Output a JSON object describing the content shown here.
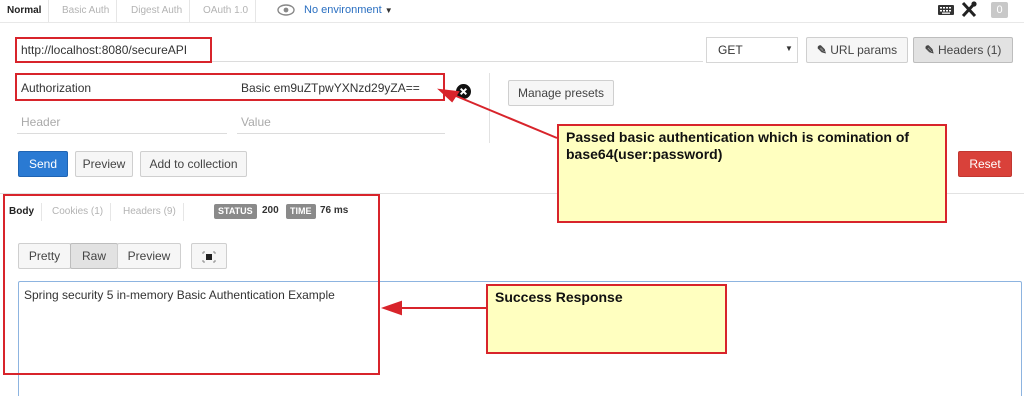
{
  "auth_tabs": [
    "Normal",
    "Basic Auth",
    "Digest Auth",
    "OAuth 1.0"
  ],
  "environment": {
    "label": "No environment",
    "icon": "eye-icon"
  },
  "toolbar_icons": {
    "keyboard": "keyboard-icon",
    "tools": "wrench-icon",
    "count": "0"
  },
  "request": {
    "url": "http://localhost:8080/secureAPI",
    "method": "GET",
    "url_params_label": "URL params",
    "headers_label": "Headers (1)"
  },
  "headers": [
    {
      "key": "Authorization",
      "value": "Basic em9uZTpwYXNzd29yZA=="
    }
  ],
  "new_header": {
    "key_placeholder": "Header",
    "value_placeholder": "Value"
  },
  "manage_presets_label": "Manage presets",
  "actions": {
    "send": "Send",
    "preview": "Preview",
    "add_to_collection": "Add to collection",
    "reset": "Reset"
  },
  "response": {
    "tabs": [
      "Body",
      "Cookies (1)",
      "Headers (9)"
    ],
    "status_label": "STATUS",
    "status_value": "200",
    "time_label": "TIME",
    "time_value": "76 ms",
    "view_modes": [
      "Pretty",
      "Raw",
      "Preview"
    ],
    "selected_view": "Raw",
    "body": "Spring security 5 in-memory Basic Authentication Example"
  },
  "annotations": {
    "auth_note": "Passed basic authentication which is comination of base64(user:password)",
    "success_note": "Success Response"
  },
  "colors": {
    "send": "#2a7ad3",
    "reset": "#d9413a",
    "annotation_border": "#d8242b",
    "note_fill": "#ffffc0"
  }
}
